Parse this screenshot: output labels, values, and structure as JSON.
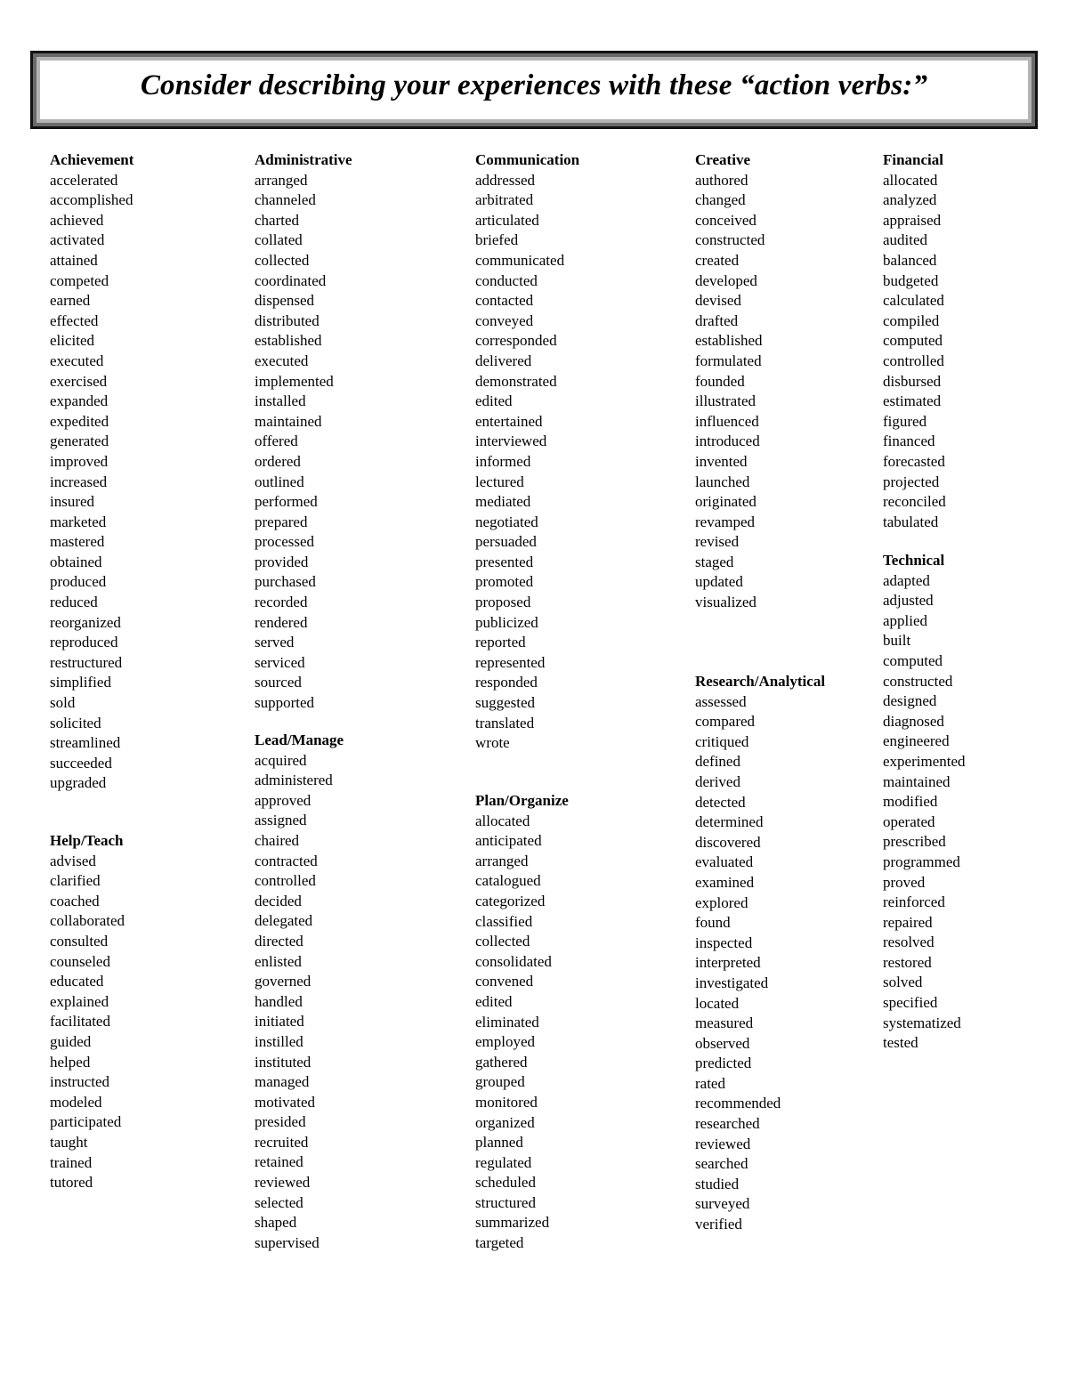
{
  "title": "Consider describing your experiences with these “action verbs:”",
  "sections": {
    "achievement": {
      "heading": "Achievement",
      "verbs": [
        "accelerated",
        "accomplished",
        "achieved",
        "activated",
        "attained",
        "competed",
        "earned",
        "effected",
        "elicited",
        "executed",
        "exercised",
        "expanded",
        "expedited",
        "generated",
        "improved",
        "increased",
        "insured",
        "marketed",
        "mastered",
        "obtained",
        "produced",
        "reduced",
        "reorganized",
        "reproduced",
        "restructured",
        "simplified",
        "sold",
        "solicited",
        "streamlined",
        "succeeded",
        "upgraded"
      ]
    },
    "help_teach": {
      "heading": "Help/Teach",
      "verbs": [
        "advised",
        "clarified",
        "coached",
        "collaborated",
        "consulted",
        "counseled",
        "educated",
        "explained",
        "facilitated",
        "guided",
        "helped",
        "instructed",
        "modeled",
        "participated",
        "taught",
        "trained",
        "tutored"
      ]
    },
    "administrative": {
      "heading": "Administrative",
      "verbs": [
        "arranged",
        "channeled",
        "charted",
        "collated",
        "collected",
        "coordinated",
        "dispensed",
        "distributed",
        "established",
        "executed",
        "implemented",
        "installed",
        "maintained",
        "offered",
        "ordered",
        "outlined",
        "performed",
        "prepared",
        "processed",
        "provided",
        "purchased",
        "recorded",
        "rendered",
        "served",
        "serviced",
        "sourced",
        "supported"
      ]
    },
    "lead_manage": {
      "heading": "Lead/Manage",
      "verbs": [
        "acquired",
        "administered",
        "approved",
        "assigned",
        "chaired",
        "contracted",
        "controlled",
        "decided",
        "delegated",
        "directed",
        "enlisted",
        "governed",
        "handled",
        "initiated",
        "instilled",
        "instituted",
        "managed",
        "motivated",
        "presided",
        "recruited",
        "retained",
        "reviewed",
        "selected",
        "shaped",
        "supervised"
      ]
    },
    "communication": {
      "heading": "Communication",
      "verbs": [
        "addressed",
        "arbitrated",
        "articulated",
        "briefed",
        "communicated",
        "conducted",
        "contacted",
        "conveyed",
        "corresponded",
        "delivered",
        "demonstrated",
        "edited",
        "entertained",
        "interviewed",
        "informed",
        "lectured",
        "mediated",
        "negotiated",
        "persuaded",
        "presented",
        "promoted",
        "proposed",
        "publicized",
        "reported",
        "represented",
        "responded",
        "suggested",
        "translated",
        "wrote"
      ]
    },
    "plan_organize": {
      "heading": "Plan/Organize",
      "verbs": [
        "allocated",
        "anticipated",
        "arranged",
        "catalogued",
        "categorized",
        "classified",
        "collected",
        "consolidated",
        "convened",
        "edited",
        "eliminated",
        "employed",
        "gathered",
        "grouped",
        "monitored",
        "organized",
        "planned",
        "regulated",
        "scheduled",
        "structured",
        "summarized",
        "targeted"
      ]
    },
    "creative": {
      "heading": "Creative",
      "verbs": [
        "authored",
        "changed",
        "conceived",
        "constructed",
        "created",
        "developed",
        "devised",
        "drafted",
        "established",
        "formulated",
        "founded",
        "illustrated",
        "influenced",
        "introduced",
        "invented",
        "launched",
        "originated",
        "revamped",
        "revised",
        "staged",
        "updated",
        "visualized"
      ]
    },
    "research_analytical": {
      "heading": "Research/Analytical",
      "verbs": [
        "assessed",
        "compared",
        "critiqued",
        "defined",
        "derived",
        "detected",
        "determined",
        "discovered",
        "evaluated",
        "examined",
        "explored",
        "found",
        "inspected",
        "interpreted",
        "investigated",
        "located",
        "measured",
        "observed",
        "predicted",
        "rated",
        "recommended",
        "researched",
        "reviewed",
        "searched",
        "studied",
        "surveyed",
        "verified"
      ]
    },
    "financial": {
      "heading": "Financial",
      "verbs": [
        "allocated",
        "analyzed",
        "appraised",
        "audited",
        "balanced",
        "budgeted",
        "calculated",
        "compiled",
        "computed",
        "controlled",
        "disbursed",
        "estimated",
        "figured",
        "financed",
        "forecasted",
        "projected",
        "reconciled",
        "tabulated"
      ]
    },
    "technical": {
      "heading": "Technical",
      "verbs": [
        "adapted",
        "adjusted",
        "applied",
        "built",
        "computed",
        "constructed",
        "designed",
        "diagnosed",
        "engineered",
        "experimented",
        "maintained",
        "modified",
        "operated",
        "prescribed",
        "programmed",
        "proved",
        "reinforced",
        "repaired",
        "resolved",
        "restored",
        "solved",
        "specified",
        "systematized",
        "tested"
      ]
    }
  }
}
